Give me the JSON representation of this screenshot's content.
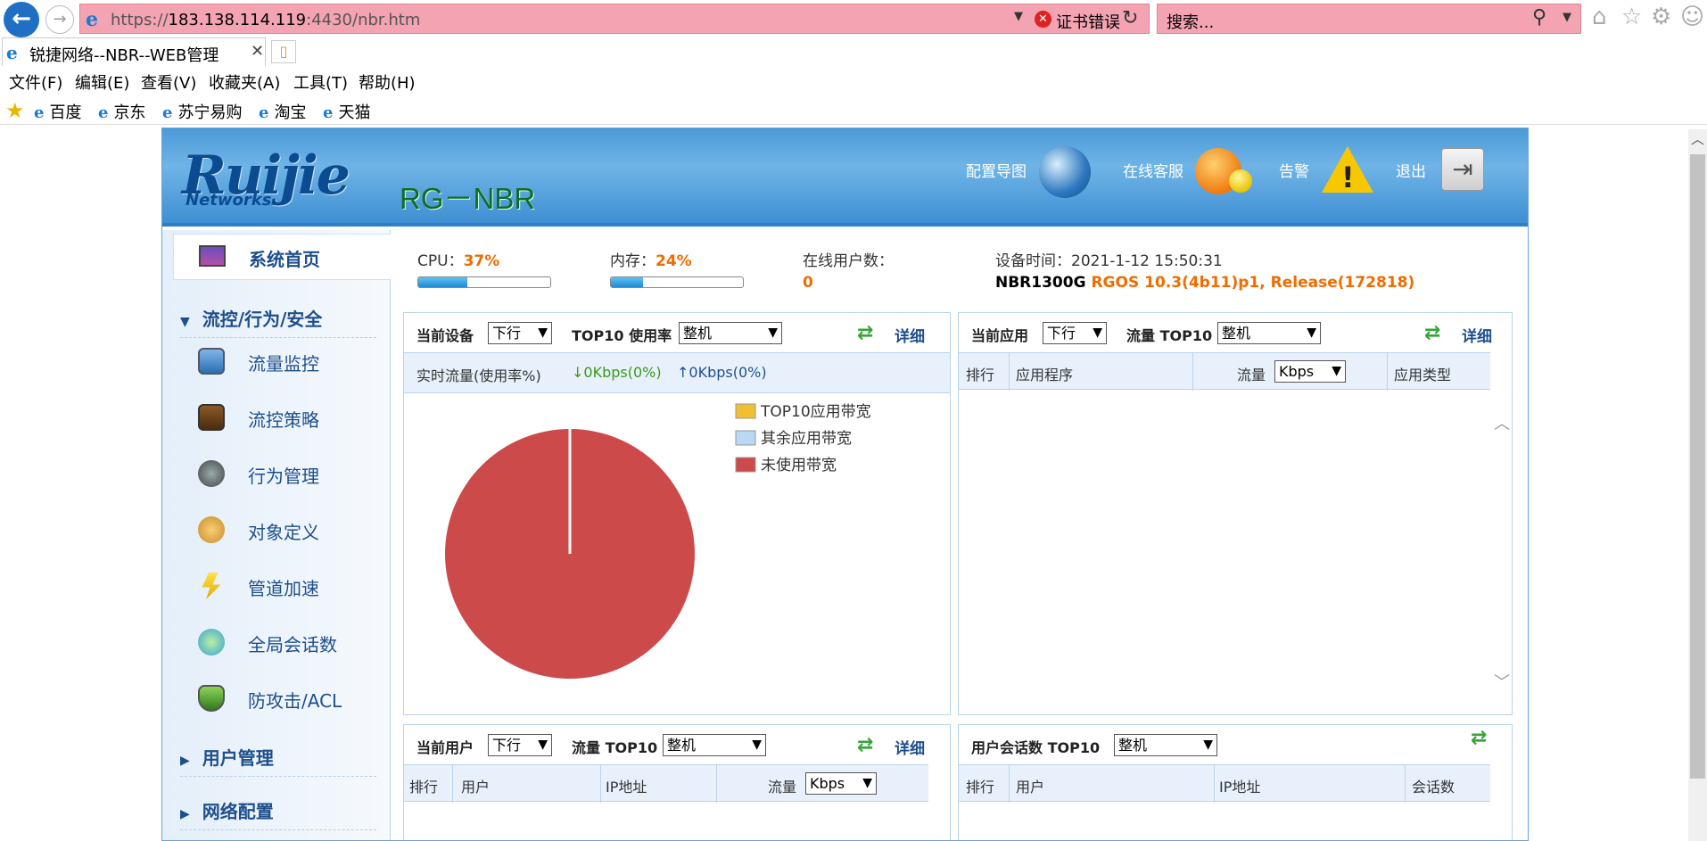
{
  "browser": {
    "url_prefix": "https://",
    "url_host": "183.138.114.119",
    "url_rest": ":4430/nbr.htm",
    "cert_error": "证书错误",
    "search_placeholder": "搜索...",
    "tab_title": "锐捷网络--NBR--WEB管理",
    "menu": [
      "文件(F)",
      "编辑(E)",
      "查看(V)",
      "收藏夹(A)",
      "工具(T)",
      "帮助(H)"
    ],
    "favorites": [
      "百度",
      "京东",
      "苏宁易购",
      "淘宝",
      "天猫"
    ]
  },
  "header": {
    "logo": "Ruijie",
    "logo_sub": "Networks",
    "product": "RG－NBR",
    "links": [
      "配置导图",
      "在线客服",
      "告警",
      "退出"
    ]
  },
  "sidebar": {
    "home": "系统首页",
    "group1": "流控/行为/安全",
    "items": [
      "流量监控",
      "流控策略",
      "行为管理",
      "对象定义",
      "管道加速",
      "全局会话数",
      "防攻击/ACL"
    ],
    "group2": "用户管理",
    "group3": "网络配置"
  },
  "stats": {
    "cpu_label": "CPU：",
    "cpu_value": "37%",
    "cpu_fraction": 0.37,
    "mem_label": "内存：",
    "mem_value": "24%",
    "mem_fraction": 0.24,
    "online_label": "在线用户数：",
    "online_value": "0",
    "time_label": "设备时间：",
    "time_value": "2021-1-12 15:50:31",
    "model": "NBR1300G",
    "version": "RGOS 10.3(4b11)p1, Release(172818)"
  },
  "panel_device": {
    "label": "当前设备",
    "dir": "下行",
    "top_label": "TOP10 使用率",
    "scope": "整机",
    "detail": "详细",
    "realtime_label": "实时流量(使用率%)",
    "down": "↓0Kbps(0%)",
    "up": "↑0Kbps(0%)",
    "legend": [
      "TOP10应用带宽",
      "其余应用带宽",
      "未使用带宽"
    ],
    "colors": [
      "#f0c030",
      "#b8d8f4",
      "#cc4a4a"
    ]
  },
  "panel_app": {
    "label": "当前应用",
    "dir": "下行",
    "top_label": "流量 TOP10",
    "scope": "整机",
    "detail": "详细",
    "cols": [
      "排行",
      "应用程序",
      "流量",
      "应用类型"
    ],
    "unit": "Kbps"
  },
  "panel_user": {
    "label": "当前用户",
    "dir": "下行",
    "top_label": "流量 TOP10",
    "scope": "整机",
    "detail": "详细",
    "cols": [
      "排行",
      "用户",
      "IP地址",
      "流量"
    ],
    "unit": "Kbps"
  },
  "panel_session": {
    "top_label": "用户会话数 TOP10",
    "scope": "整机",
    "cols": [
      "排行",
      "用户",
      "IP地址",
      "会话数"
    ]
  },
  "chart_data": {
    "type": "pie",
    "categories": [
      "TOP10应用带宽",
      "其余应用带宽",
      "未使用带宽"
    ],
    "values": [
      0,
      0,
      100
    ]
  }
}
